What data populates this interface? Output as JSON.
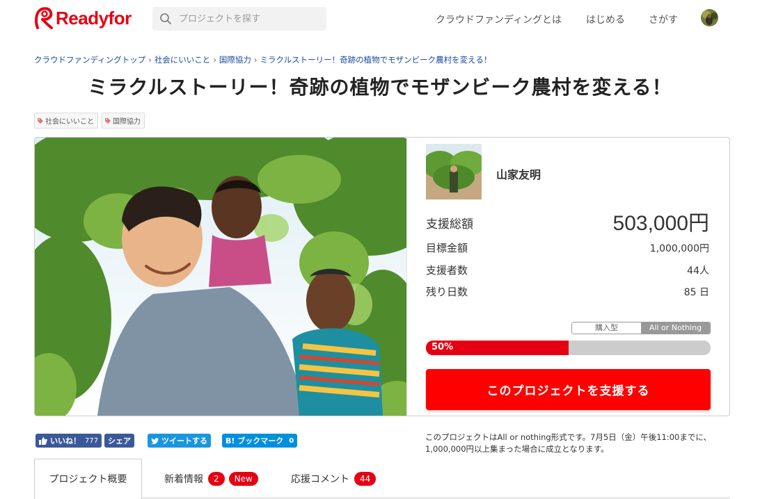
{
  "header": {
    "logo_text": "Readyfor",
    "search_placeholder": "プロジェクトを探す",
    "nav": [
      "クラウドファンディングとは",
      "はじめる",
      "さがす"
    ]
  },
  "breadcrumb": [
    "クラウドファンディングトップ",
    "社会にいいこと",
    "国際協力",
    "ミラクルストーリー！奇跡の植物でモザンビーク農村を変える！"
  ],
  "project": {
    "title": "ミラクルストーリー！奇跡の植物でモザンビーク農村を変える！",
    "tags": [
      "社会にいいこと",
      "国際協力"
    ],
    "owner_name": "山家友明"
  },
  "stats": {
    "total_label": "支援総額",
    "total_value": "503,000円",
    "goal_label": "目標金額",
    "goal_value": "1,000,000円",
    "backers_label": "支援者数",
    "backers_value": "44人",
    "days_label": "残り日数",
    "days_value": "85 日"
  },
  "type_toggle": {
    "buy": "購入型",
    "aon": "All or Nothing"
  },
  "progress": {
    "label": "50%",
    "fraction": 0.5
  },
  "support_button": "このプロジェクトを支援する",
  "social": {
    "like": "いいね！",
    "like_count": "777",
    "share": "シェア",
    "tweet": "ツイートする",
    "bookmark": "B! ブックマーク",
    "bookmark_count": "0"
  },
  "note": "このプロジェクトはAll or nothing形式です。7月5日（金）午後11:00までに、1,000,000円以上集まった場合に成立となります。",
  "tabs": [
    {
      "label": "プロジェクト概要"
    },
    {
      "label": "新着情報",
      "badge": "2",
      "badge2": "New"
    },
    {
      "label": "応援コメント",
      "badge": "44"
    }
  ],
  "colors": {
    "brand": "#e60012",
    "link": "#1a4aa0",
    "facebook": "#3b5998",
    "twitter": "#1b95e0"
  }
}
